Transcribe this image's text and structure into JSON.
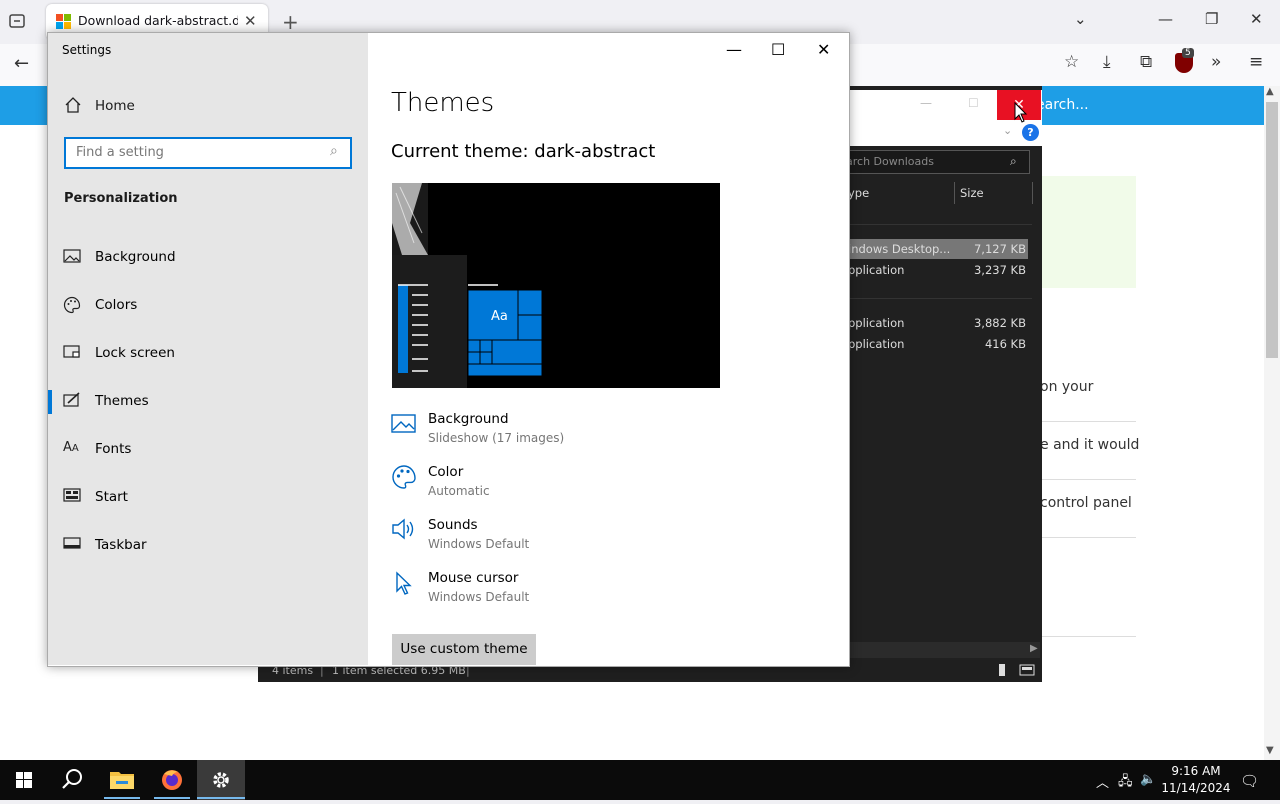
{
  "browser": {
    "tab_title": "Download dark-abstract.deskthemepack",
    "new_tab": "+",
    "close_glyph": "✕"
  },
  "webpage": {
    "search_placeholder": "earch...",
    "text_lines": [
      "on your",
      "e and it would",
      "control panel"
    ]
  },
  "explorer": {
    "search_placeholder": "arch Downloads",
    "columns": {
      "type": "ype",
      "size": "Size"
    },
    "rows": [
      {
        "type": "indows Desktop...",
        "size": "7,127 KB",
        "selected": true
      },
      {
        "type": "pplication",
        "size": "3,237 KB",
        "selected": false
      },
      {
        "type": "pplication",
        "size": "3,882 KB",
        "selected": false
      },
      {
        "type": "pplication",
        "size": "416 KB",
        "selected": false
      }
    ],
    "status": {
      "items": "4 items",
      "selected": "1 item selected  6.95 MB"
    },
    "help": "?"
  },
  "settings": {
    "window_title": "Settings",
    "home": "Home",
    "search_placeholder": "Find a setting",
    "section": "Personalization",
    "nav": [
      {
        "label": "Background",
        "icon": "image-icon"
      },
      {
        "label": "Colors",
        "icon": "palette-icon"
      },
      {
        "label": "Lock screen",
        "icon": "lock-screen-icon"
      },
      {
        "label": "Themes",
        "icon": "themes-icon",
        "active": true
      },
      {
        "label": "Fonts",
        "icon": "fonts-icon"
      },
      {
        "label": "Start",
        "icon": "start-icon"
      },
      {
        "label": "Taskbar",
        "icon": "taskbar-icon"
      }
    ],
    "page_title": "Themes",
    "current_theme": "Current theme: dark-abstract",
    "preview_tile_label": "Aa",
    "options": [
      {
        "label": "Background",
        "value": "Slideshow (17 images)",
        "icon": "image-icon"
      },
      {
        "label": "Color",
        "value": "Automatic",
        "icon": "palette-icon"
      },
      {
        "label": "Sounds",
        "value": "Windows Default",
        "icon": "speaker-icon"
      },
      {
        "label": "Mouse cursor",
        "value": "Windows Default",
        "icon": "cursor-icon"
      }
    ],
    "custom_theme_button": "Use custom theme",
    "accent": "#0078d7"
  },
  "taskbar": {
    "time": "9:16 AM",
    "date": "11/14/2024"
  }
}
